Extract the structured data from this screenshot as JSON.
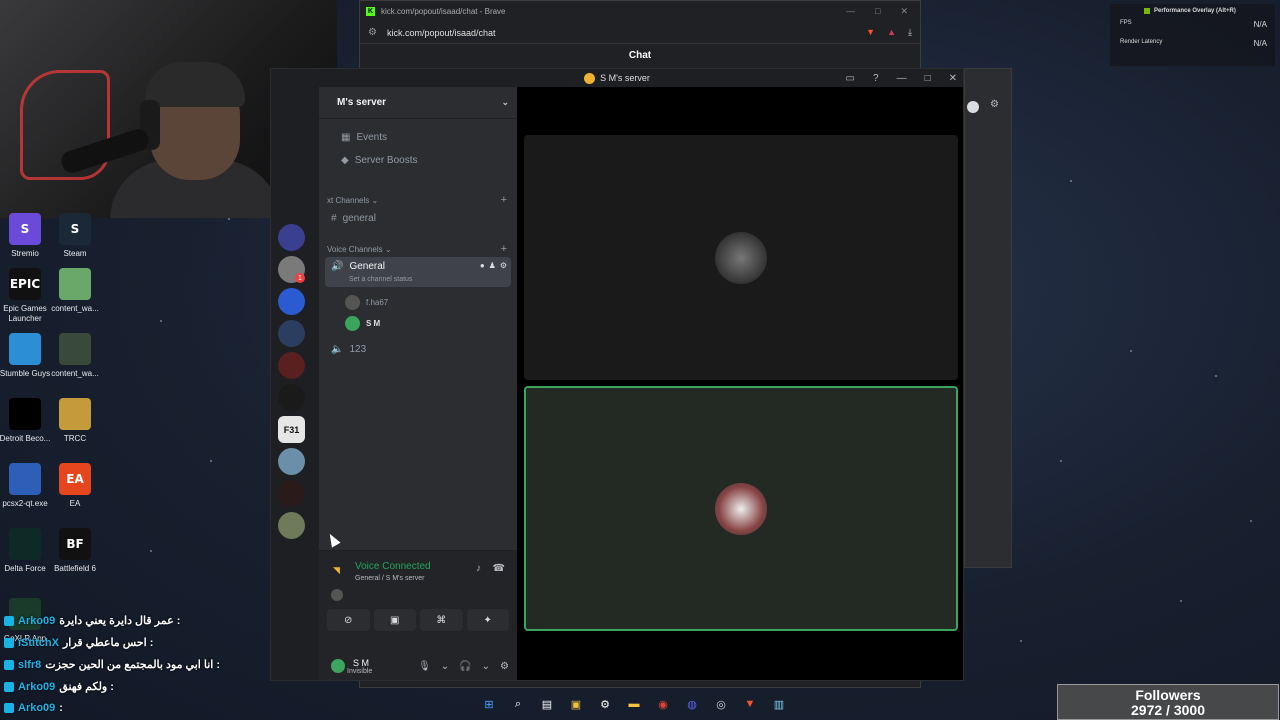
{
  "desktop": {
    "icons": [
      {
        "label": "Stremio",
        "color": "#6a4ad8"
      },
      {
        "label": "Steam",
        "color": "#1b2838"
      },
      {
        "label": "Epic Games Launcher",
        "color": "#111111"
      },
      {
        "label": "content_wa...",
        "color": "#6aa86a"
      },
      {
        "label": "Stumble Guys",
        "color": "#2c8fd6"
      },
      {
        "label": "content_wa...",
        "color": "#3a4a3a"
      },
      {
        "label": "Detroit Beco...",
        "color": "#000000"
      },
      {
        "label": "TRCC",
        "color": "#c59a3a"
      },
      {
        "label": "pcsx2-qt.exe",
        "color": "#2d5fb8"
      },
      {
        "label": "EA",
        "color": "#e5461d"
      },
      {
        "label": "Delta Force",
        "color": "#0d2a26"
      },
      {
        "label": "Battlefield 6",
        "color": "#111111"
      },
      {
        "label": "GoXLR App",
        "color": "#1a3a2a"
      }
    ],
    "icon_glyphs": [
      "S",
      "S",
      "EPIC",
      "",
      "",
      "",
      "",
      "",
      "",
      "EA",
      "",
      "BF",
      ""
    ]
  },
  "browser": {
    "tab_title": "kick.com/popout/isaad/chat - Brave",
    "url": "kick.com/popout/isaad/chat",
    "page_heading": "Chat"
  },
  "discord": {
    "window_title": "S M's server",
    "server_name": "M's server",
    "nav": [
      {
        "label": "Events",
        "icon": "calendar-icon"
      },
      {
        "label": "Server Boosts",
        "icon": "boost-icon"
      }
    ],
    "text_category": "xt Channels",
    "text_channels": [
      {
        "name": "general"
      }
    ],
    "voice_category": "Voice Channels",
    "voice_channels": [
      {
        "name": "General",
        "status": "Set a channel status",
        "members": [
          {
            "name": "f.ha67",
            "color": "#555555"
          },
          {
            "name": "S M",
            "color": "#3ba55d"
          }
        ]
      },
      {
        "name": "123"
      }
    ],
    "guilds": [
      {
        "label": "",
        "color": "#3b3f8f"
      },
      {
        "label": "",
        "color": "#7a7a7a",
        "badge": "1"
      },
      {
        "label": "",
        "color": "#2a5bd0"
      },
      {
        "label": "",
        "color": "#2c3e60"
      },
      {
        "label": "",
        "color": "#5a1f1f"
      },
      {
        "label": "",
        "color": "#1a1a1a"
      },
      {
        "label": "F31",
        "color": "#e6e6e6"
      },
      {
        "label": "",
        "color": "#6b8fa8"
      },
      {
        "label": "",
        "color": "#2a1a1a"
      },
      {
        "label": "",
        "color": "#6e7a5a"
      }
    ],
    "voice_panel": {
      "title": "Voice Connected",
      "subtitle": "General / S M's server"
    },
    "user": {
      "name": "S M",
      "status": "Invisible"
    }
  },
  "perf_overlay": {
    "title": "Performance Overlay (Alt+R)",
    "rows": [
      {
        "label": "FPS",
        "value": "N/A"
      },
      {
        "label": "Render Latency",
        "value": "N/A"
      }
    ]
  },
  "chat": [
    {
      "user": "Arko09",
      "text": "عمر قال دايرة يعني دايرة :"
    },
    {
      "user": "iStitchX",
      "text": "احس ماعطي قرار :"
    },
    {
      "user": "slfr8",
      "text": "انا ابي مود بالمجتمع من الحين حجزت :"
    },
    {
      "user": "Arko09",
      "text": "ولكم فهنق :"
    },
    {
      "user": "Arko09",
      "text": ":"
    }
  ],
  "followers": {
    "label": "Followers",
    "count": "2972 / 3000"
  }
}
